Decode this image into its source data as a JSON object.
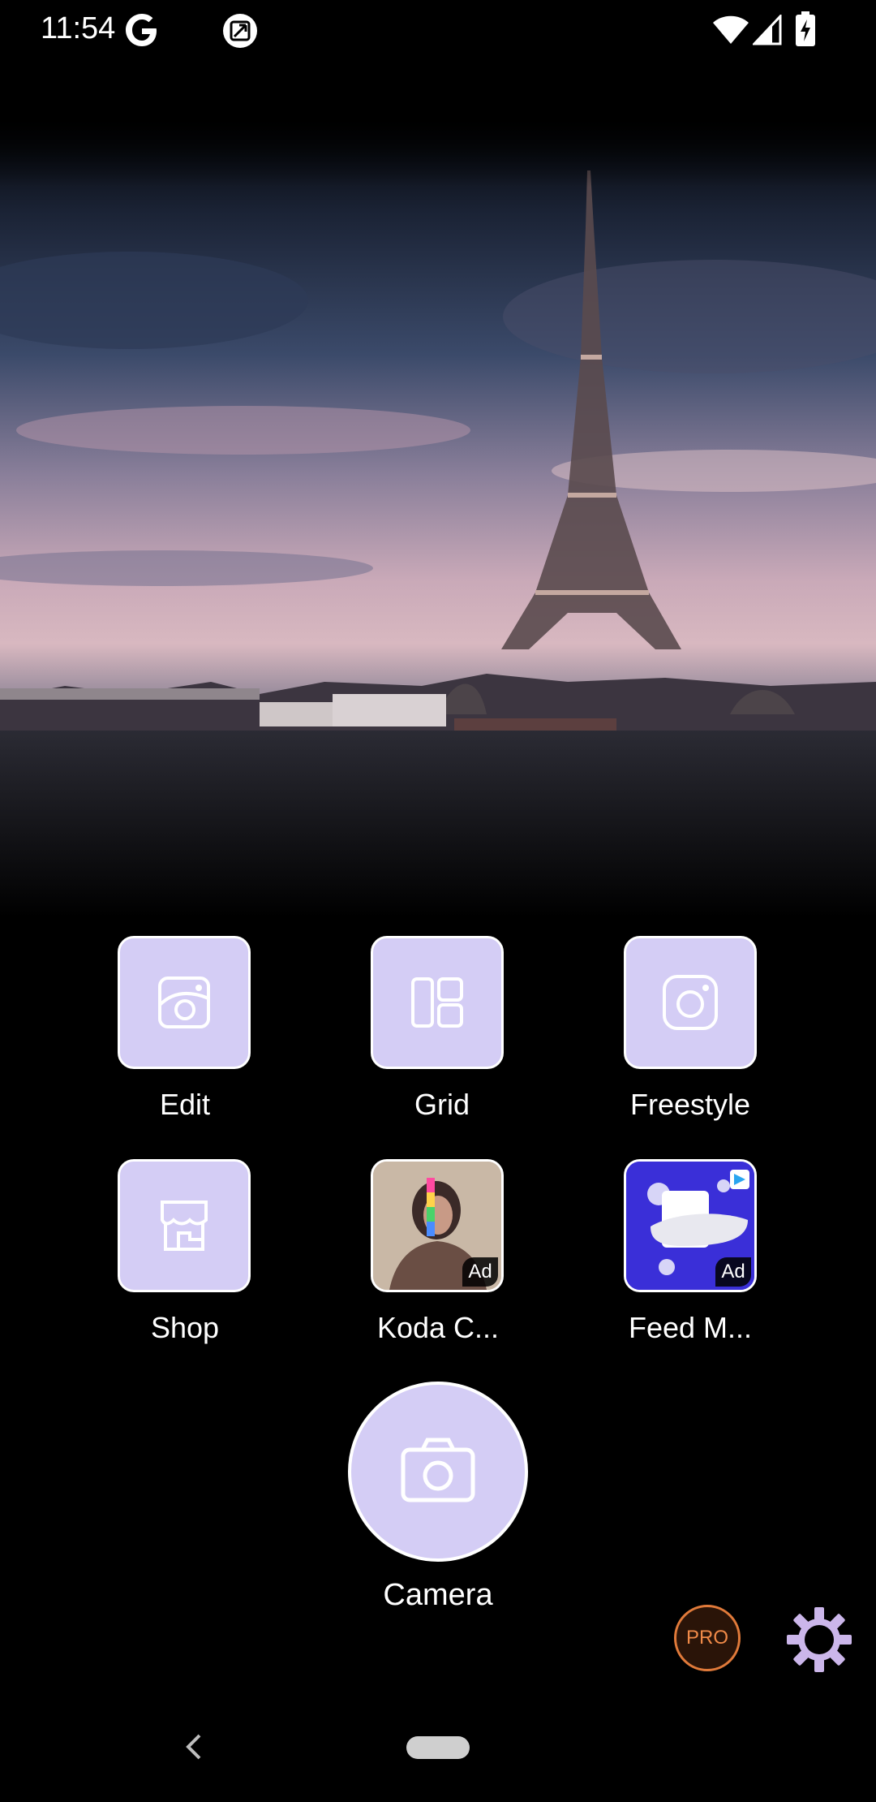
{
  "status_bar": {
    "time": "11:54",
    "icons": [
      "google-g-icon",
      "screenshot-icon",
      "wifi-icon",
      "cell-signal-icon",
      "battery-charging-icon"
    ]
  },
  "hero": {
    "description_icon": "eiffel-tower-photo"
  },
  "tiles": [
    {
      "label": "Edit",
      "icon": "photo-edit-icon",
      "ad": ""
    },
    {
      "label": "Grid",
      "icon": "grid-layout-icon",
      "ad": ""
    },
    {
      "label": "Freestyle",
      "icon": "freestyle-icon",
      "ad": ""
    },
    {
      "label": "Shop",
      "icon": "shop-icon",
      "ad": ""
    },
    {
      "label": "Koda C...",
      "icon": "koda-ad-thumbnail",
      "ad": "Ad"
    },
    {
      "label": "Feed M...",
      "icon": "feed-ad-thumbnail",
      "ad": "Ad"
    }
  ],
  "camera": {
    "label": "Camera",
    "icon": "camera-icon"
  },
  "pro": {
    "label": "PRO"
  },
  "settings": {
    "icon": "gear-icon"
  },
  "colors": {
    "tile_bg": "#d4cdf5",
    "pro_accent": "#e07a3a",
    "gear": "#cbb6ea"
  }
}
